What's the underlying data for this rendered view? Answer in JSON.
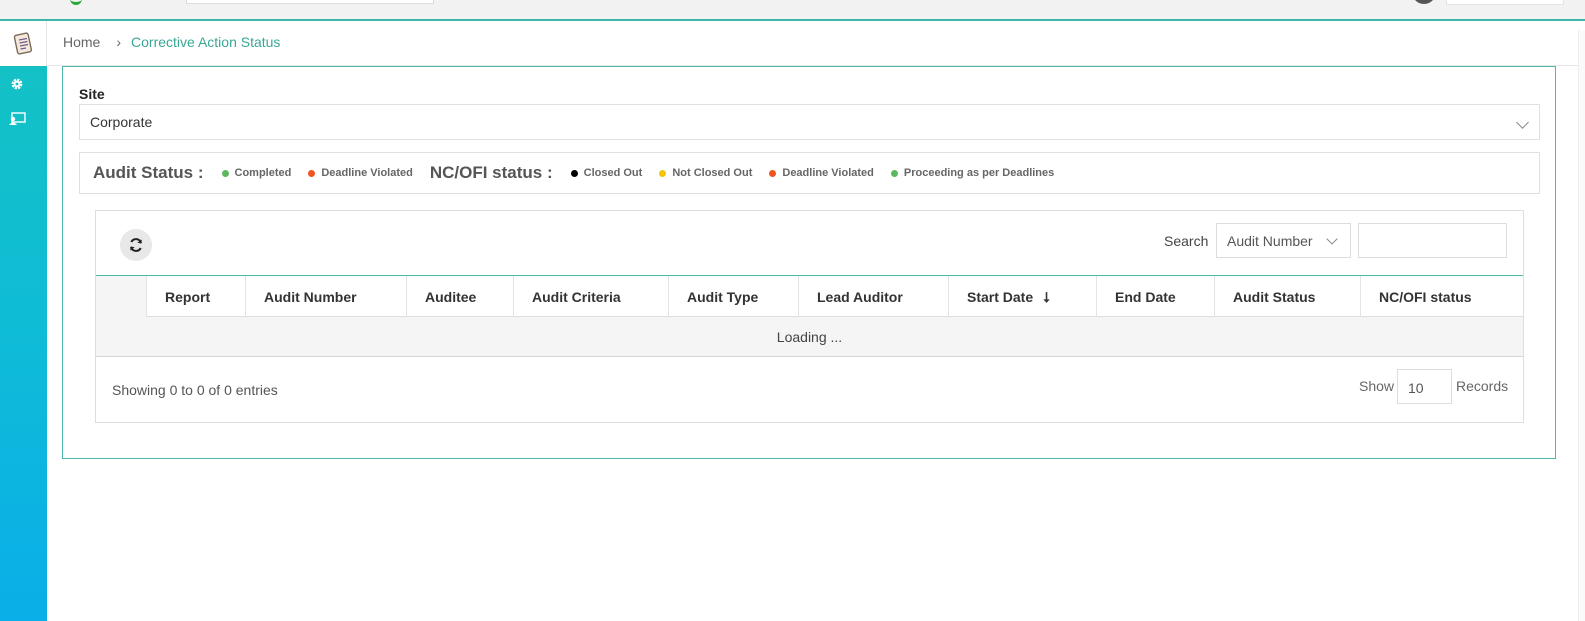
{
  "breadcrumb": {
    "home": "Home",
    "separator": "›",
    "current": "Corrective Action Status"
  },
  "sidebar": {
    "items": [
      {
        "icon": "checklist-icon"
      },
      {
        "icon": "gear-icon"
      },
      {
        "icon": "user-card-icon"
      }
    ]
  },
  "site": {
    "label": "Site",
    "selected": "Corporate"
  },
  "legend": {
    "audit_title": "Audit Status :",
    "audit_items": [
      {
        "label": "Completed",
        "color": "#5cb85c"
      },
      {
        "label": "Deadline Violated",
        "color": "#f0541e"
      }
    ],
    "ncofi_title": "NC/OFI status :",
    "ncofi_items": [
      {
        "label": "Closed Out",
        "color": "#000000"
      },
      {
        "label": "Not Closed Out",
        "color": "#f5c400"
      },
      {
        "label": "Deadline Violated",
        "color": "#f0541e"
      },
      {
        "label": "Proceeding as per Deadlines",
        "color": "#5cb85c"
      }
    ]
  },
  "table": {
    "search_label": "Search",
    "search_field": "Audit Number",
    "search_value": "",
    "columns": [
      "",
      "Report",
      "Audit Number",
      "Auditee",
      "Audit Criteria",
      "Audit Type",
      "Lead Auditor",
      "Start Date",
      "End Date",
      "Audit Status",
      "NC/OFI status"
    ],
    "sort_indicator": "⭣",
    "loading_text": "Loading ...",
    "info": "Showing 0 to 0 of 0 entries",
    "show_label": "Show",
    "page_size": "10",
    "records_label": "Records"
  },
  "colors": {
    "accent": "#3aa796",
    "border_accent": "#4cb8aa"
  }
}
